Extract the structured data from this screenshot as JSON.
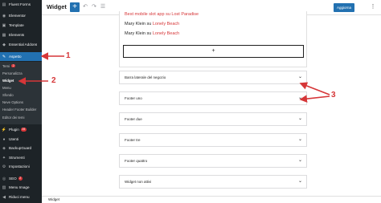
{
  "topbar": {
    "title": "Widget",
    "add_icon": "plus-icon",
    "undo_icon": "undo-icon",
    "redo_icon": "redo-icon",
    "list_view_icon": "list-view-icon",
    "update_label": "Aggiorna",
    "more_icon": "more-vertical-icon"
  },
  "sidebar": {
    "top_items": [
      {
        "label": "Fluent Forms",
        "icon": "fluent-forms-icon"
      },
      {
        "label": "Elementor",
        "icon": "elementor-icon"
      },
      {
        "label": "Template",
        "icon": "template-icon"
      },
      {
        "label": "Elements",
        "icon": "elements-icon"
      },
      {
        "label": "Essential Addons",
        "icon": "essential-addons-icon"
      }
    ],
    "active_item": {
      "label": "Aspetto",
      "icon": "paintbrush-icon"
    },
    "sub_items": [
      "Temi",
      "Personalizza",
      "Widget",
      "Menu",
      "Sfondo",
      "Neve Options",
      "Header Footer Builder",
      "Editor dei temi"
    ],
    "temi_badge": "2",
    "bottom_items": [
      {
        "label": "Plugin",
        "icon": "plugin-icon",
        "badge": "15"
      },
      {
        "label": "Utenti",
        "icon": "users-icon"
      },
      {
        "label": "BackupGuard",
        "icon": "backup-icon"
      },
      {
        "label": "Strumenti",
        "icon": "tools-icon"
      },
      {
        "label": "Impostazioni",
        "icon": "settings-icon"
      },
      {
        "label": "SEO",
        "icon": "seo-icon",
        "badge": "2"
      },
      {
        "label": "Menu Image",
        "icon": "menu-image-icon"
      },
      {
        "label": "Riduci menu",
        "icon": "collapse-icon"
      }
    ]
  },
  "content": {
    "posts": [
      {
        "text": "Best mobile slot app ",
        "prep": "su ",
        "link": "Lost Paradise"
      },
      {
        "text": "Mary Klein ",
        "prep": "su ",
        "link": "Lonely Beach"
      },
      {
        "text": "Mary Klein ",
        "prep": "su ",
        "link": "Lonely Beach"
      }
    ],
    "add_block_label": "+",
    "panels": [
      "Barra laterale del negozio",
      "Footer uno",
      "Footer due",
      "Footer tre",
      "Footer quattro",
      "Widget non attivi"
    ]
  },
  "annotations": [
    "1",
    "2",
    "3"
  ],
  "footer": {
    "breadcrumb": "Widget"
  },
  "colors": {
    "accent": "#2271b1",
    "sidebar": "#1d2327",
    "annotation": "#d63638"
  }
}
